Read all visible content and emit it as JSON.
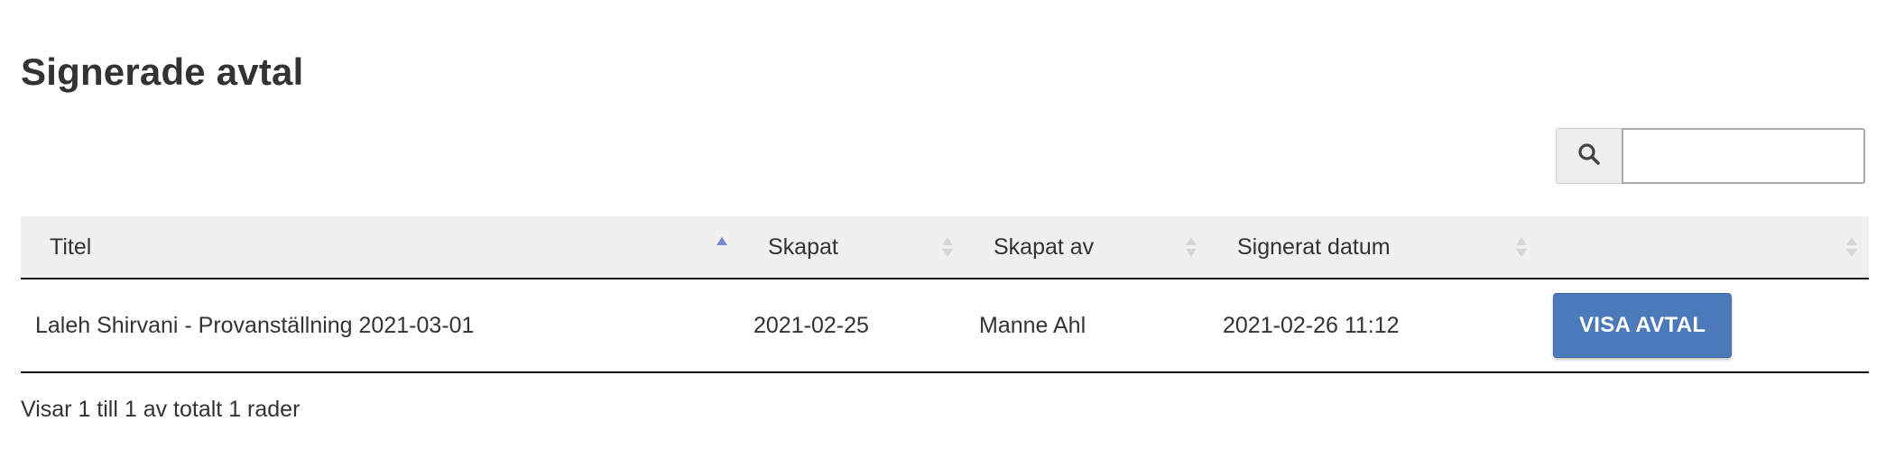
{
  "page": {
    "title": "Signerade avtal"
  },
  "search": {
    "icon": "search-icon",
    "value": ""
  },
  "table": {
    "columns": [
      {
        "label": "Titel",
        "sort": "ascending"
      },
      {
        "label": "Skapat",
        "sort": "none"
      },
      {
        "label": "Skapat av",
        "sort": "none"
      },
      {
        "label": "Signerat datum",
        "sort": "none"
      },
      {
        "label": "",
        "sort": "none"
      }
    ],
    "rows": [
      {
        "titel": "Laleh Shirvani - Provanställning 2021-03-01",
        "skapat": "2021-02-25",
        "skapat_av": "Manne Ahl",
        "signerat_datum": "2021-02-26 11:12",
        "action_label": "VISA AVTAL"
      }
    ]
  },
  "footer": {
    "info": "Visar 1 till 1 av totalt 1 rader"
  },
  "colors": {
    "sort_active": "#7b86d9",
    "sort_inactive": "#d6d6d6",
    "button": "#4a7ab9"
  }
}
